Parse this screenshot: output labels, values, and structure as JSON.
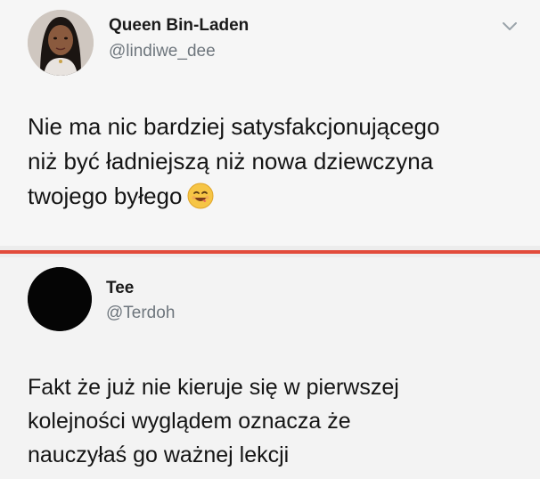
{
  "tweets": [
    {
      "author": {
        "name": "Queen Bin-Laden",
        "handle": "@lindiwe_dee",
        "avatar": "avatar-photo"
      },
      "menu_icon": "chevron-down-icon",
      "text_lines": [
        "Nie ma nic bardziej satysfakcjonującego",
        "niż być ładniejszą niż nowa dziewczyna",
        "twojego byłego"
      ],
      "emoji": "smiling-face-emoji"
    },
    {
      "author": {
        "name": "Tee",
        "handle": "@Terdoh",
        "avatar": "avatar-black"
      },
      "text_lines": [
        "Fakt że już nie kieruje się w pierwszej",
        "kolejności wyglądem oznacza że",
        "nauczyłaś go ważnej lekcji"
      ]
    }
  ],
  "colors": {
    "divider": "#e24b3b",
    "handle": "#6e767d",
    "background": "#f6f6f6"
  }
}
